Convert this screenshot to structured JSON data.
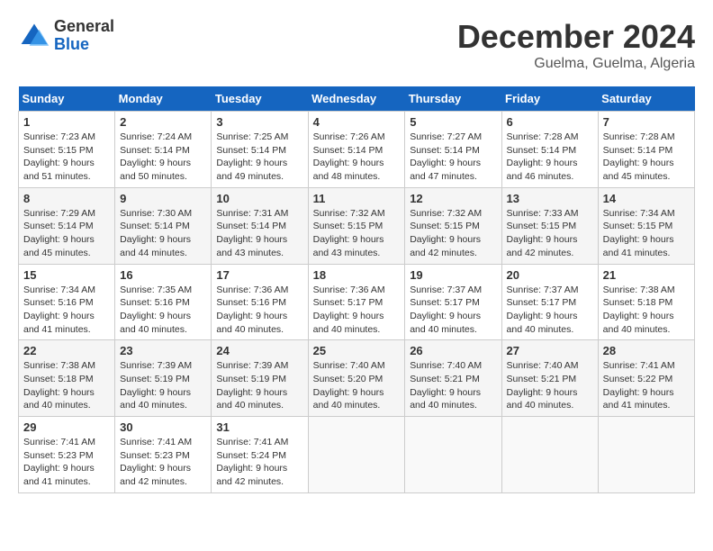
{
  "logo": {
    "line1": "General",
    "line2": "Blue"
  },
  "title": "December 2024",
  "location": "Guelma, Guelma, Algeria",
  "days_of_week": [
    "Sunday",
    "Monday",
    "Tuesday",
    "Wednesday",
    "Thursday",
    "Friday",
    "Saturday"
  ],
  "weeks": [
    [
      {
        "day": "1",
        "detail": "Sunrise: 7:23 AM\nSunset: 5:15 PM\nDaylight: 9 hours\nand 51 minutes."
      },
      {
        "day": "2",
        "detail": "Sunrise: 7:24 AM\nSunset: 5:14 PM\nDaylight: 9 hours\nand 50 minutes."
      },
      {
        "day": "3",
        "detail": "Sunrise: 7:25 AM\nSunset: 5:14 PM\nDaylight: 9 hours\nand 49 minutes."
      },
      {
        "day": "4",
        "detail": "Sunrise: 7:26 AM\nSunset: 5:14 PM\nDaylight: 9 hours\nand 48 minutes."
      },
      {
        "day": "5",
        "detail": "Sunrise: 7:27 AM\nSunset: 5:14 PM\nDaylight: 9 hours\nand 47 minutes."
      },
      {
        "day": "6",
        "detail": "Sunrise: 7:28 AM\nSunset: 5:14 PM\nDaylight: 9 hours\nand 46 minutes."
      },
      {
        "day": "7",
        "detail": "Sunrise: 7:28 AM\nSunset: 5:14 PM\nDaylight: 9 hours\nand 45 minutes."
      }
    ],
    [
      {
        "day": "8",
        "detail": "Sunrise: 7:29 AM\nSunset: 5:14 PM\nDaylight: 9 hours\nand 45 minutes."
      },
      {
        "day": "9",
        "detail": "Sunrise: 7:30 AM\nSunset: 5:14 PM\nDaylight: 9 hours\nand 44 minutes."
      },
      {
        "day": "10",
        "detail": "Sunrise: 7:31 AM\nSunset: 5:14 PM\nDaylight: 9 hours\nand 43 minutes."
      },
      {
        "day": "11",
        "detail": "Sunrise: 7:32 AM\nSunset: 5:15 PM\nDaylight: 9 hours\nand 43 minutes."
      },
      {
        "day": "12",
        "detail": "Sunrise: 7:32 AM\nSunset: 5:15 PM\nDaylight: 9 hours\nand 42 minutes."
      },
      {
        "day": "13",
        "detail": "Sunrise: 7:33 AM\nSunset: 5:15 PM\nDaylight: 9 hours\nand 42 minutes."
      },
      {
        "day": "14",
        "detail": "Sunrise: 7:34 AM\nSunset: 5:15 PM\nDaylight: 9 hours\nand 41 minutes."
      }
    ],
    [
      {
        "day": "15",
        "detail": "Sunrise: 7:34 AM\nSunset: 5:16 PM\nDaylight: 9 hours\nand 41 minutes."
      },
      {
        "day": "16",
        "detail": "Sunrise: 7:35 AM\nSunset: 5:16 PM\nDaylight: 9 hours\nand 40 minutes."
      },
      {
        "day": "17",
        "detail": "Sunrise: 7:36 AM\nSunset: 5:16 PM\nDaylight: 9 hours\nand 40 minutes."
      },
      {
        "day": "18",
        "detail": "Sunrise: 7:36 AM\nSunset: 5:17 PM\nDaylight: 9 hours\nand 40 minutes."
      },
      {
        "day": "19",
        "detail": "Sunrise: 7:37 AM\nSunset: 5:17 PM\nDaylight: 9 hours\nand 40 minutes."
      },
      {
        "day": "20",
        "detail": "Sunrise: 7:37 AM\nSunset: 5:17 PM\nDaylight: 9 hours\nand 40 minutes."
      },
      {
        "day": "21",
        "detail": "Sunrise: 7:38 AM\nSunset: 5:18 PM\nDaylight: 9 hours\nand 40 minutes."
      }
    ],
    [
      {
        "day": "22",
        "detail": "Sunrise: 7:38 AM\nSunset: 5:18 PM\nDaylight: 9 hours\nand 40 minutes."
      },
      {
        "day": "23",
        "detail": "Sunrise: 7:39 AM\nSunset: 5:19 PM\nDaylight: 9 hours\nand 40 minutes."
      },
      {
        "day": "24",
        "detail": "Sunrise: 7:39 AM\nSunset: 5:19 PM\nDaylight: 9 hours\nand 40 minutes."
      },
      {
        "day": "25",
        "detail": "Sunrise: 7:40 AM\nSunset: 5:20 PM\nDaylight: 9 hours\nand 40 minutes."
      },
      {
        "day": "26",
        "detail": "Sunrise: 7:40 AM\nSunset: 5:21 PM\nDaylight: 9 hours\nand 40 minutes."
      },
      {
        "day": "27",
        "detail": "Sunrise: 7:40 AM\nSunset: 5:21 PM\nDaylight: 9 hours\nand 40 minutes."
      },
      {
        "day": "28",
        "detail": "Sunrise: 7:41 AM\nSunset: 5:22 PM\nDaylight: 9 hours\nand 41 minutes."
      }
    ],
    [
      {
        "day": "29",
        "detail": "Sunrise: 7:41 AM\nSunset: 5:23 PM\nDaylight: 9 hours\nand 41 minutes."
      },
      {
        "day": "30",
        "detail": "Sunrise: 7:41 AM\nSunset: 5:23 PM\nDaylight: 9 hours\nand 42 minutes."
      },
      {
        "day": "31",
        "detail": "Sunrise: 7:41 AM\nSunset: 5:24 PM\nDaylight: 9 hours\nand 42 minutes."
      },
      null,
      null,
      null,
      null
    ]
  ]
}
